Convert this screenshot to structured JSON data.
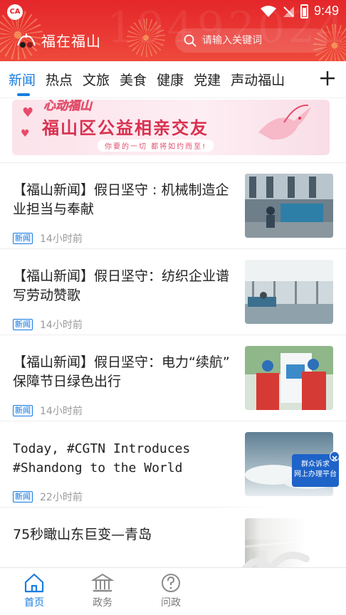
{
  "status_bar": {
    "time": "9:49",
    "app_icon_text": "CA"
  },
  "header": {
    "app_name": "福在福山",
    "search_placeholder": "请输入关键词",
    "bg_color": "#e4262a"
  },
  "tabs": {
    "items": [
      "新闻",
      "热点",
      "文旅",
      "美食",
      "健康",
      "党建",
      "声动福山"
    ],
    "active_index": 0,
    "accent": "#1a7de0"
  },
  "banner": {
    "subtitle": "心动福山",
    "title": "福山区公益相亲交友",
    "slogan": "你要的一切 都将如约而至!"
  },
  "news": [
    {
      "title": "【福山新闻】假日坚守 : 机械制造企业担当与奉献",
      "tag": "新闻",
      "time": "14小时前",
      "thumb": "factory-machinery"
    },
    {
      "title": "【福山新闻】假日坚守：纺织企业谱写劳动赞歌",
      "tag": "新闻",
      "time": "14小时前",
      "thumb": "textile-workshop"
    },
    {
      "title": "【福山新闻】假日坚守：电力“续航” 保障节日绿色出行",
      "tag": "新闻",
      "time": "14小时前",
      "thumb": "power-workers"
    },
    {
      "title": "Today, #CGTN Introduces #Shandong to the World",
      "tag": "新闻",
      "time": "22小时前",
      "thumb": "aerial-sky",
      "thumb_badge": "群众诉求\n网上办理平台"
    },
    {
      "title": "75秒瞰山东巨变—青岛",
      "tag": "",
      "time": "",
      "thumb": "aerial-city"
    }
  ],
  "bottom_nav": {
    "items": [
      {
        "label": "首页",
        "icon": "home-icon"
      },
      {
        "label": "政务",
        "icon": "government-building-icon"
      },
      {
        "label": "问政",
        "icon": "question-icon"
      }
    ],
    "active_index": 0
  }
}
